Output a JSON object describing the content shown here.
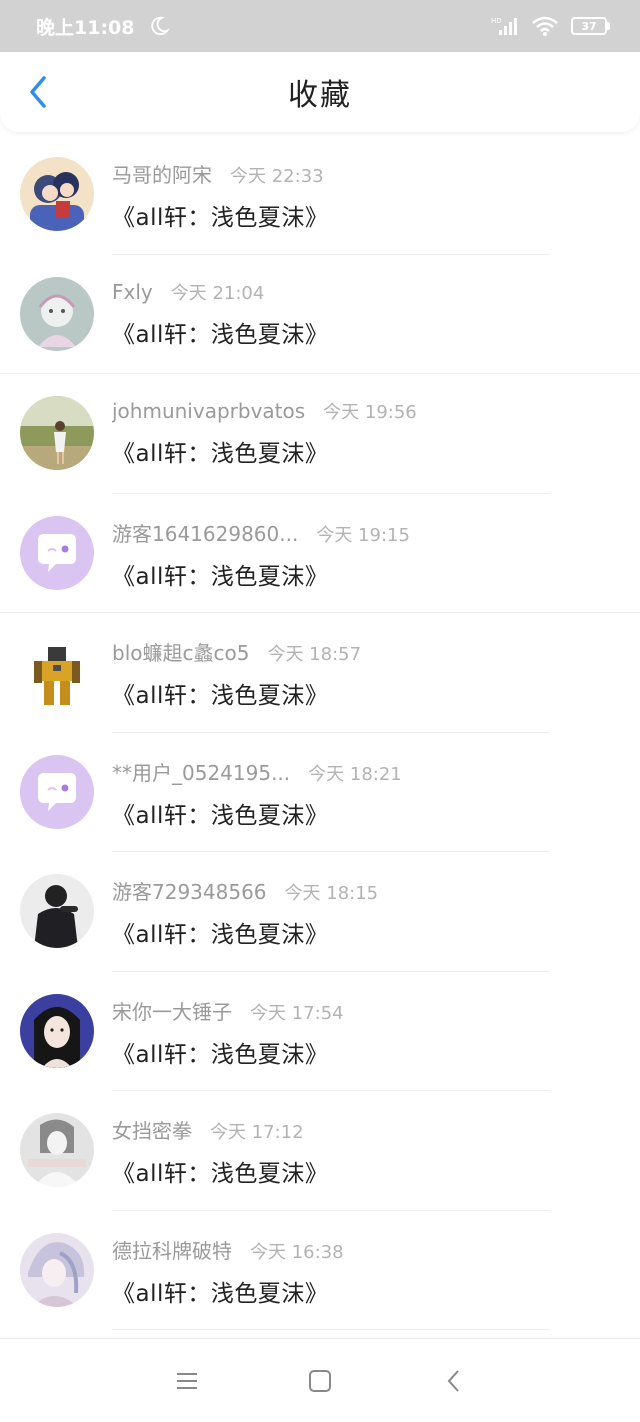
{
  "status_bar": {
    "time": "晚上11:08",
    "battery": "37"
  },
  "header": {
    "title": "收藏"
  },
  "items": [
    {
      "user": "马哥的阿宋",
      "time": "今天 22:33",
      "title": "《all轩：浅色夏沫》",
      "avatar": "anime-couple-avatar"
    },
    {
      "user": "Fxly",
      "time": "今天 21:04",
      "title": "《all轩：浅色夏沫》",
      "avatar": "sketch-girl-avatar"
    },
    {
      "user": "johmunivaprbvatos",
      "time": "今天 19:56",
      "title": "《all轩：浅色夏沫》",
      "avatar": "photo-girl-avatar"
    },
    {
      "user": "游客1641629860...",
      "time": "今天 19:15",
      "title": "《all轩：浅色夏沫》",
      "avatar": "default-chat-avatar"
    },
    {
      "user": "blo蠊趄c蠡co5",
      "time": "今天 18:57",
      "title": "《all轩：浅色夏沫》",
      "avatar": "robot-avatar"
    },
    {
      "user": "**用户_0524195...",
      "time": "今天 18:21",
      "title": "《all轩：浅色夏沫》",
      "avatar": "default-chat-avatar"
    },
    {
      "user": "游客729348566",
      "time": "今天 18:15",
      "title": "《all轩：浅色夏沫》",
      "avatar": "hooded-figure-avatar"
    },
    {
      "user": "宋你一大锤子",
      "time": "今天 17:54",
      "title": "《all轩：浅色夏沫》",
      "avatar": "illustrated-girl-avatar"
    },
    {
      "user": "女挡密拳",
      "time": "今天 17:12",
      "title": "《all轩：浅色夏沫》",
      "avatar": "grey-photo-avatar"
    },
    {
      "user": "德拉科牌破特",
      "time": "今天 16:38",
      "title": "《all轩：浅色夏沫》",
      "avatar": "pastel-anime-avatar"
    }
  ],
  "colors": {
    "accent": "#2f8fe8",
    "status_bar_bg": "#d2d2d2",
    "default_avatar_bg": "#d9c4f2"
  }
}
